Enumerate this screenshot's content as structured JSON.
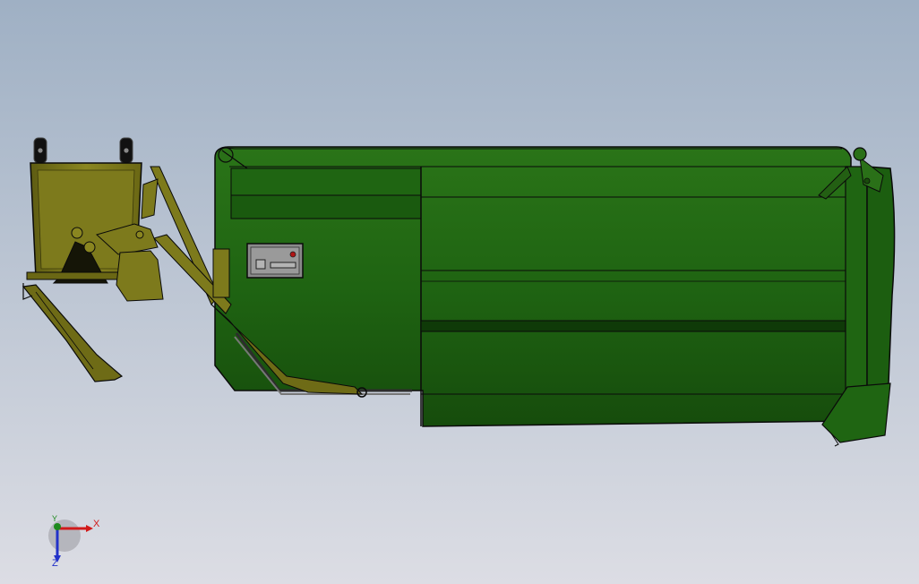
{
  "viewport": {
    "background_top": "#9fb0c4",
    "background_bottom": "#dcdde4"
  },
  "colors": {
    "container_green": "#1c5e10",
    "container_dark": "#0f3a08",
    "container_light": "#2c7a1a",
    "bin_olive": "#7d7a1c",
    "bin_olive_dark": "#4e4c0f",
    "outline": "#0a0a0a",
    "control_panel": "#8a8a8a",
    "control_led": "#b01515"
  },
  "model": {
    "name_icon": "garbage-truck-compactor-icon",
    "parts": [
      "waste-bin",
      "lifting-arm",
      "container-body",
      "tail-door",
      "control-box"
    ]
  },
  "triad": {
    "x_label": "X",
    "y_label": "Y",
    "z_label": "Z",
    "icon": "coordinate-triad-icon"
  }
}
